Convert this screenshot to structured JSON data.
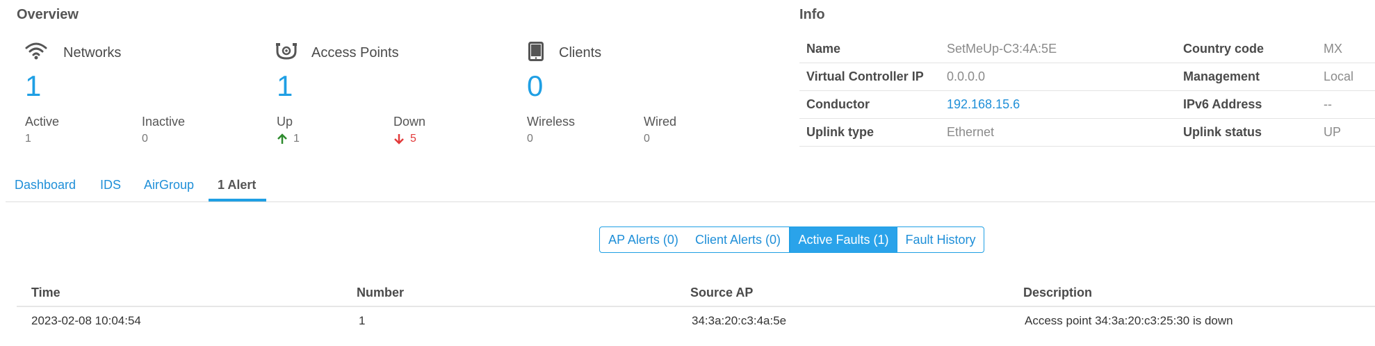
{
  "overview": {
    "title": "Overview",
    "networks": {
      "label": "Networks",
      "count": "1",
      "active_label": "Active",
      "active": "1",
      "inactive_label": "Inactive",
      "inactive": "0"
    },
    "access_points": {
      "label": "Access Points",
      "count": "1",
      "up_label": "Up",
      "up": "1",
      "down_label": "Down",
      "down": "5"
    },
    "clients": {
      "label": "Clients",
      "count": "0",
      "wireless_label": "Wireless",
      "wireless": "0",
      "wired_label": "Wired",
      "wired": "0"
    }
  },
  "info": {
    "title": "Info",
    "rows": [
      {
        "k1": "Name",
        "v1": "SetMeUp-C3:4A:5E",
        "k2": "Country code",
        "v2": "MX"
      },
      {
        "k1": "Virtual Controller IP",
        "v1": "0.0.0.0",
        "k2": "Management",
        "v2": "Local"
      },
      {
        "k1": "Conductor",
        "v1": "192.168.15.6",
        "k2": "IPv6 Address",
        "v2": "--"
      },
      {
        "k1": "Uplink type",
        "v1": "Ethernet",
        "k2": "Uplink status",
        "v2": "UP"
      }
    ]
  },
  "tabs": [
    "Dashboard",
    "IDS",
    "AirGroup",
    "1 Alert"
  ],
  "alert_filters": [
    "AP Alerts (0)",
    "Client Alerts (0)",
    "Active Faults (1)",
    "Fault History"
  ],
  "alerts_table": {
    "headers": [
      "Time",
      "Number",
      "Source AP",
      "Description"
    ],
    "rows": [
      [
        "2023-02-08 10:04:54",
        "1",
        "34:3a:20:c3:4a:5e",
        "Access point 34:3a:20:c3:25:30 is down"
      ]
    ]
  },
  "colors": {
    "accent": "#1f9fe4",
    "up": "#2e8b2e",
    "down": "#e23a3a"
  }
}
